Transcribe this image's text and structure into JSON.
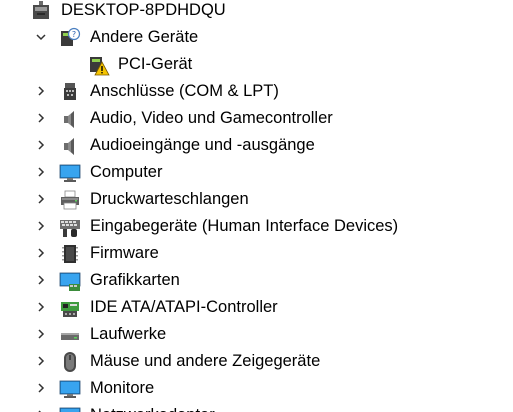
{
  "tree": {
    "root": {
      "label": "DESKTOP-8PDHDQU",
      "icon": "computer-root-icon",
      "expanded": true
    },
    "items": [
      {
        "label": "Andere Geräte",
        "icon": "unknown-device-icon",
        "expanded": true,
        "level": 1
      },
      {
        "label": "PCI-Gerät",
        "icon": "warning-device-icon",
        "level": 2
      },
      {
        "label": "Anschlüsse (COM & LPT)",
        "icon": "port-connector-icon",
        "expanded": false,
        "level": 1
      },
      {
        "label": "Audio, Video und Gamecontroller",
        "icon": "speaker-icon",
        "expanded": false,
        "level": 1
      },
      {
        "label": "Audioeingänge und -ausgänge",
        "icon": "speaker-icon",
        "expanded": false,
        "level": 1
      },
      {
        "label": "Computer",
        "icon": "monitor-icon",
        "expanded": false,
        "level": 1
      },
      {
        "label": "Druckwarteschlangen",
        "icon": "printer-icon",
        "expanded": false,
        "level": 1
      },
      {
        "label": "Eingabegeräte (Human Interface Devices)",
        "icon": "hid-keyboard-icon",
        "expanded": false,
        "level": 1
      },
      {
        "label": "Firmware",
        "icon": "firmware-chip-icon",
        "expanded": false,
        "level": 1
      },
      {
        "label": "Grafikkarten",
        "icon": "display-adapter-icon",
        "expanded": false,
        "level": 1
      },
      {
        "label": "IDE ATA/ATAPI-Controller",
        "icon": "ide-controller-icon",
        "expanded": false,
        "level": 1
      },
      {
        "label": "Laufwerke",
        "icon": "disk-drive-icon",
        "expanded": false,
        "level": 1
      },
      {
        "label": "Mäuse und andere Zeigegeräte",
        "icon": "mouse-icon",
        "expanded": false,
        "level": 1
      },
      {
        "label": "Monitore",
        "icon": "monitor-icon",
        "expanded": false,
        "level": 1
      },
      {
        "label": "Netzwerkadapter",
        "icon": "network-adapter-icon",
        "expanded": false,
        "level": 1
      }
    ]
  }
}
